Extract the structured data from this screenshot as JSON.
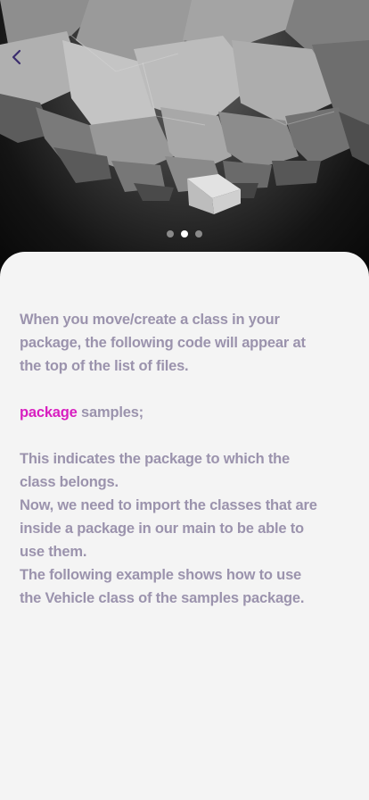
{
  "nav": {
    "back_icon": "chevron-left-icon"
  },
  "pagination": {
    "total": 3,
    "active_index": 1
  },
  "colors": {
    "keyword": "#d81fc0",
    "body_text": "#9b93ad",
    "card_bg": "#f4f4f4",
    "back_icon": "#3b2d6e"
  },
  "content": {
    "para1": "When you move/create a class in your package, the following code will appear at the top of the list of files.",
    "code_keyword": "package",
    "code_rest": " samples;",
    "para2": "This indicates the package to which the class belongs.",
    "para3": "Now, we need to import the classes that are inside a package in our main to be able to use them.",
    "para4": "The following example shows how to use the Vehicle class of the samples package."
  }
}
